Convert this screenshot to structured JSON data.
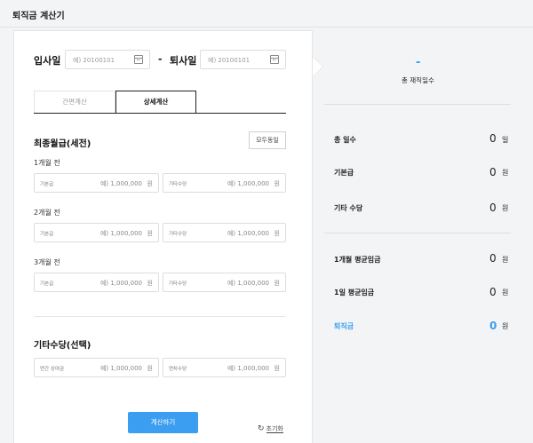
{
  "page_title": "퇴직금 계산기",
  "dates": {
    "start_label": "입사일",
    "end_label": "퇴사일",
    "separator": "-",
    "start_placeholder": "예) 20100101",
    "end_placeholder": "예) 20100101"
  },
  "tabs": {
    "simple": "간편계산",
    "detail": "상세계산"
  },
  "wage": {
    "title": "최종월급(세전)",
    "all_same_button": "모두동일",
    "months": [
      {
        "label": "1개월 전",
        "base_label": "기본급",
        "base_value": "예) 1,000,000",
        "base_unit": "원",
        "other_label": "기타수당",
        "other_value": "예) 1,000,000",
        "other_unit": "원"
      },
      {
        "label": "2개월 전",
        "base_label": "기본급",
        "base_value": "예) 1,000,000",
        "base_unit": "원",
        "other_label": "기타수당",
        "other_value": "예) 1,000,000",
        "other_unit": "원"
      },
      {
        "label": "3개월 전",
        "base_label": "기본급",
        "base_value": "예) 1,000,000",
        "base_unit": "원",
        "other_label": "기타수당",
        "other_value": "예) 1,000,000",
        "other_unit": "원"
      }
    ]
  },
  "extra": {
    "title": "기타수당(선택)",
    "annual_label": "연간 상여금",
    "annual_value": "예) 1,000,000",
    "annual_unit": "원",
    "leave_label": "연차수당",
    "leave_value": "예) 1,000,000",
    "leave_unit": "원"
  },
  "actions": {
    "calculate": "계산하기",
    "reset": "초기화"
  },
  "summary": {
    "days_value": "-",
    "days_label": "총 재직일수",
    "rows": [
      {
        "label": "총 일수",
        "value": "0",
        "unit": "일"
      },
      {
        "label": "기본급",
        "value": "0",
        "unit": "원"
      },
      {
        "label": "기타 수당",
        "value": "0",
        "unit": "원"
      },
      {
        "label": "1개월 평균임금",
        "value": "0",
        "unit": "원"
      },
      {
        "label": "1일 평균임금",
        "value": "0",
        "unit": "원"
      },
      {
        "label": "퇴직금",
        "value": "0",
        "unit": "원"
      }
    ]
  },
  "colors": {
    "accent": "#3c9ef0"
  },
  "icons": {
    "calendar": "calendar-icon",
    "reset": "refresh-icon"
  }
}
